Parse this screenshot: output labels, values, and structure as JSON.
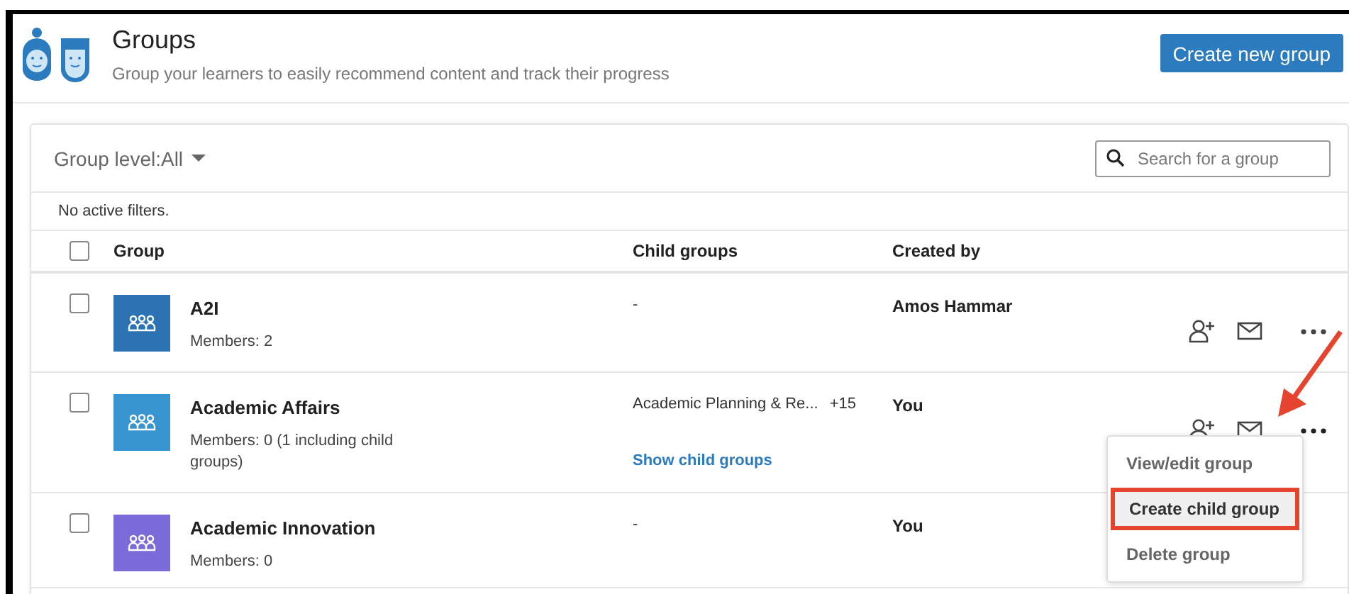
{
  "header": {
    "title": "Groups",
    "subtitle": "Group your learners to easily recommend content and track their progress",
    "create_button": "Create new group"
  },
  "toolbar": {
    "group_level": "Group level:All",
    "search": {
      "placeholder": "Search for a group"
    }
  },
  "filter_status": "No active filters.",
  "table": {
    "select_all": {
      "checked": false
    },
    "columns": [
      "Group",
      "Child groups",
      "Created by"
    ],
    "rows": [
      {
        "checked": false,
        "color": "#2b73b3",
        "name": "A2I",
        "members": "Members: 2",
        "child_groups": "-",
        "created_by": "Amos Hammar",
        "menu_open": false
      },
      {
        "checked": false,
        "color": "#3895cf",
        "name": "Academic Affairs",
        "members": "Members: 0 (1 including child groups)",
        "child_groups": "Academic Planning & Re...",
        "child_count": "+15",
        "show_link": "Show child groups",
        "created_by": "You",
        "menu_open": true
      },
      {
        "checked": false,
        "color": "#7b6bd9",
        "name": "Academic Innovation",
        "members": "Members: 0",
        "child_groups": "-",
        "created_by": "You",
        "menu_open": false
      }
    ]
  },
  "menu": {
    "items": [
      {
        "label": "View/edit group",
        "selected": false
      },
      {
        "label": "Create child group",
        "selected": true
      },
      {
        "label": "Delete group",
        "selected": false
      }
    ]
  }
}
